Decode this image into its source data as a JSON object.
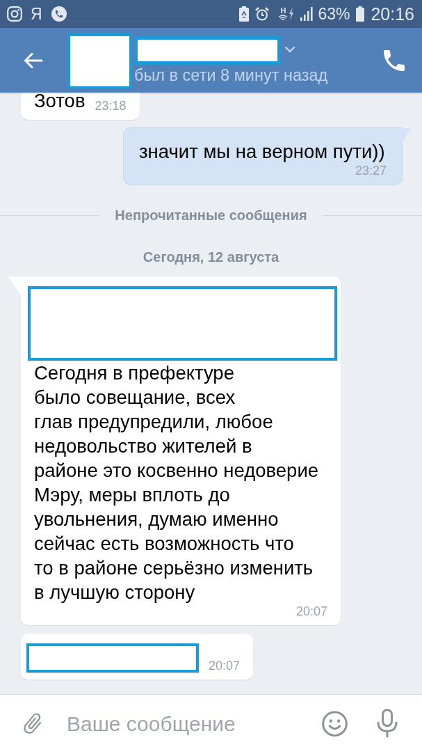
{
  "status_bar": {
    "app_letter": "Я",
    "network_type": "H",
    "battery": "63%",
    "time": "20:16"
  },
  "header": {
    "avatar": {
      "kind": "redacted"
    },
    "name": {
      "kind": "redacted"
    },
    "status": "был в сети 8 минут назад"
  },
  "chat": [
    {
      "kind": "incoming_message",
      "tail": false,
      "parts": [
        {
          "kind": "text",
          "text": "Зотов"
        }
      ],
      "time": "23:18"
    },
    {
      "kind": "outgoing_message",
      "tail": true,
      "parts": [
        {
          "kind": "text",
          "text": "значит мы на верном пути))"
        }
      ],
      "time": "23:27"
    },
    {
      "kind": "unread_divider",
      "text": "Непрочитанные сообщения"
    },
    {
      "kind": "date",
      "text": "Сегодня, 12 августа"
    },
    {
      "kind": "incoming_message",
      "tail": true,
      "parts": [
        {
          "kind": "redacted"
        },
        {
          "kind": "text",
          "text": "Сегодня в префектуре\nбыло совещание, всех\nглав предупредили, любое\nнедовольство жителей в\nрайоне это косвенно недоверие\nМэру, меры вплоть до\nувольнения, думаю именно\nсейчас есть возможность что\nто в районе серьёзно изменить\nв лучшую сторону"
        }
      ],
      "time": "20:07"
    },
    {
      "kind": "incoming_message",
      "tail": false,
      "parts": [
        {
          "kind": "redacted"
        }
      ],
      "time": "20:07"
    }
  ],
  "composer": {
    "placeholder": "Ваше сообщение"
  }
}
